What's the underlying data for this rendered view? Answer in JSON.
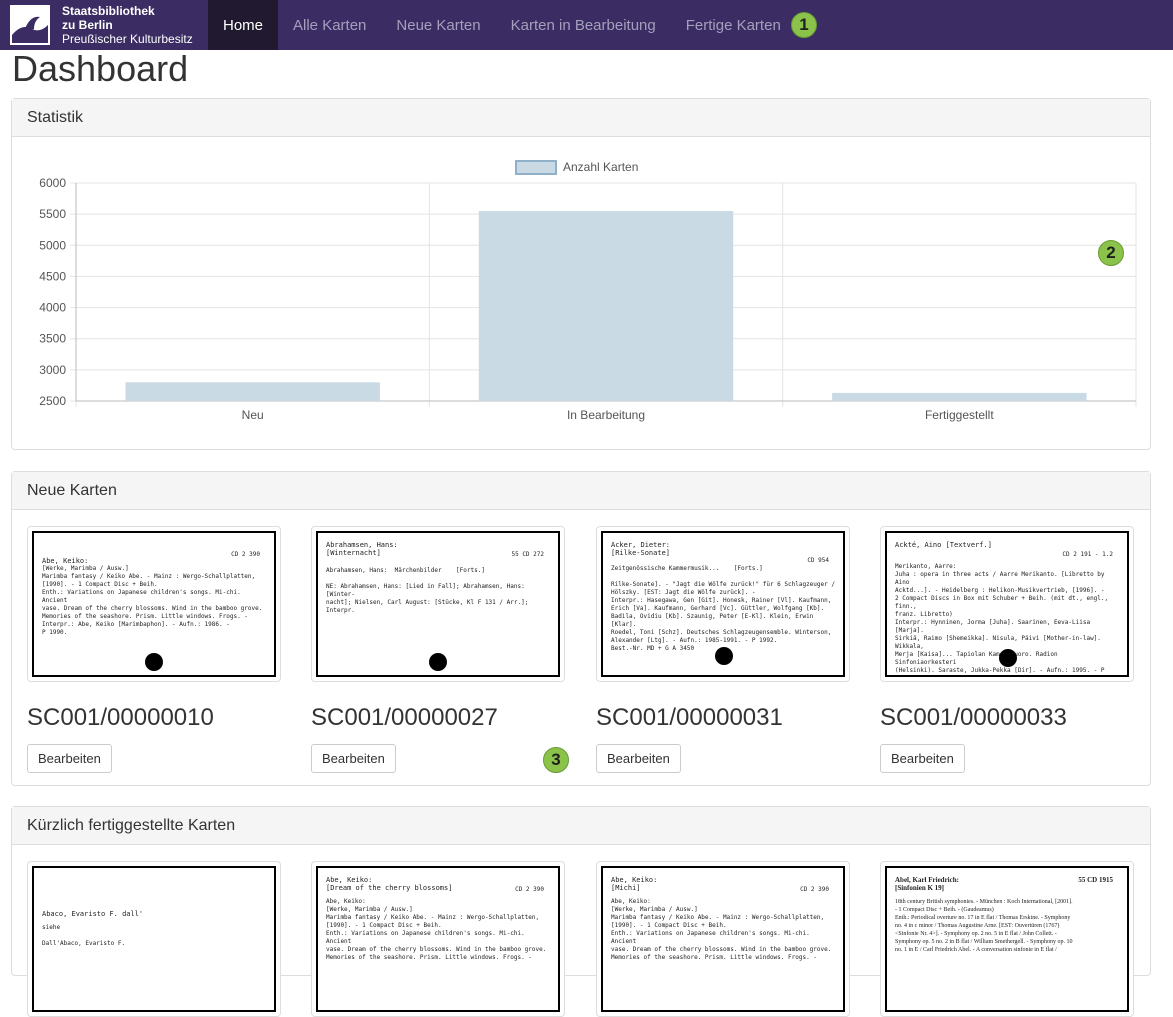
{
  "navbar": {
    "brand_line1": "Staatsbibliothek",
    "brand_line2": "zu Berlin",
    "brand_line3": "Preußischer Kulturbesitz",
    "items": [
      {
        "label": "Home",
        "active": true
      },
      {
        "label": "Alle Karten",
        "active": false
      },
      {
        "label": "Neue Karten",
        "active": false
      },
      {
        "label": "Karten in Bearbeitung",
        "active": false
      },
      {
        "label": "Fertige Karten",
        "active": false
      }
    ],
    "bg_color": "#3b2d63"
  },
  "markers": [
    "1",
    "2",
    "3"
  ],
  "page_title": "Dashboard",
  "statistik": {
    "heading": "Statistik"
  },
  "chart_data": {
    "type": "bar",
    "categories": [
      "Neu",
      "In Bearbeitung",
      "Fertiggestellt"
    ],
    "series": [
      {
        "name": "Anzahl Karten",
        "values": [
          2800,
          5550,
          2630
        ],
        "color": "#c9dae5"
      }
    ],
    "ylim": [
      2500,
      6000
    ],
    "yticks": [
      2500,
      3000,
      3500,
      4000,
      4500,
      5000,
      5500,
      6000
    ],
    "grid": true,
    "legend_position": "top-center"
  },
  "neue_karten": {
    "heading": "Neue Karten",
    "button_label": "Bearbeiten",
    "cards": [
      {
        "id": "SC001/00000010",
        "sig": "CD  2 390",
        "header": "Abe, Keiko:",
        "text": "[Werke, Marimba / Ausw.]\nMarimba fantasy / Keiko Abe. - Mainz : Wergo-Schallplatten,\n[1990]. - 1 Compact Disc + Beih.\nEnth.: Variations on Japanese children's songs. Mi-chi. Ancient\nvase. Dream of the cherry blossoms. Wind in the bamboo grove.\nMemories of the seashore. Prism. Little windows. Frogs. -\nInterpr.: Abe, Keiko [Marimbaphon]. - Aufn.: 1986. -\nP 1990."
      },
      {
        "id": "SC001/00000027",
        "sig": "55  CD  272",
        "header": "Abrahamsen, Hans:\n[Winternacht]",
        "text": "Abrahamsen, Hans:  Märchenbilder    [Forts.]\n\nNE: Abrahamsen, Hans: [Lied in Fall]; Abrahamsen, Hans: [Winter-\nnacht]; Nielsen, Carl August: [Stücke, Kl F 131 / Arr.]; Interpr."
      },
      {
        "id": "SC001/00000031",
        "sig": "CD  954",
        "header": "Acker, Dieter:\n[Rilke-Sonate]",
        "text": "Zeitgenössische Kammermusik...    [Forts.]\n\nRilke-Sonate]. - \"Jagt die Wölfe zurück!\" für 6 Schlagzeuger /\nHölszky. [EST: Jagt die Wölfe zurück]. -\nInterpr.: Hasegawa, Gen [Git]. Honesk, Rainer [Vl]. Kaufmann,\nErich [Va]. Kaufmann, Gerhard [Vc]. Güttler, Wolfgang [Kb].\nBadila, Ovidiu [Kb]. Szaunig, Peter [E-Kl]. Klein, Erwin [Klar].\nRoedel, Toni [Schz]. Deutsches Schlagzeugensemble. Winterson,\nAlexander [Ltg]. - Aufn.: 1985-1991. - P 1992.\nBest.-Nr. MD + G A 3450"
      },
      {
        "id": "SC001/00000033",
        "sig": "CD  2 191 - 1.2",
        "header": "Ackté, Aino [Textverf.]",
        "text": "Merikanto, Aarre:\nJuha : opera in three acts / Aarre Merikanto. [Libretto by Aino\nAcktd...]. - Heidelberg : Helikon-Musikvertrieb, [1996]. -\n2 Compact Discs in Box mit Schuber + Beih. (mit dt., engl., finn.,\nfranz. Libretto)\nInterpr.: Hynninen, Jorma [Juha]. Saarinen, Eeva-Liisa [Marja].\nSirkiä, Raimo [Shemeikka]. Nisula, Päivi [Mother-in-law]. Wikkala,\nMerja [Kaisa]... Tapiolan Kamarikuoro. Radion Sinfoniaorkesteri\n(Helsinki). Saraste, Jukka-Pekka [Dir]. - Aufn.: 1995. - P 1996.\nBest.-Nr. Ondine ODE 872-2 D\nNE: Ackté, Aino [Textverf.];      Interpr."
      }
    ]
  },
  "fertige_karten": {
    "heading": "Kürzlich fertiggestellte Karten",
    "cards": [
      {
        "header": "Abaco, Evaristo F. dall'",
        "sig": "",
        "text": "siehe\n\nDall'Abaco, Evaristo F."
      },
      {
        "header": "Abe, Keiko:\n[Dream of the cherry blossoms]",
        "sig": "CD  2 390",
        "text": "Abe, Keiko:\n[Werke, Marimba / Ausw.]\nMarimba fantasy / Keiko Abe. - Mainz : Wergo-Schallplatten,\n[1990]. - 1 Compact Disc + Beih.\nEnth.: Variations on Japanese children's songs. Mi-chi. Ancient\nvase. Dream of the cherry blossoms. Wind in the bamboo grove.\nMemories of the seashore. Prism. Little windows. Frogs. -"
      },
      {
        "header": "Abe, Keiko:\n[Michi]",
        "sig": "CD  2 390",
        "text": "Abe, Keiko:\n[Werke, Marimba / Ausw.]\nMarimba fantasy / Keiko Abe. - Mainz : Wergo-Schallplatten,\n[1990]. - 1 Compact Disc + Beih.\nEnth.: Variations on Japanese children's songs. Mi-chi. Ancient\nvase. Dream of the cherry blossoms. Wind in the bamboo grove.\nMemories of the seashore. Prism. Little windows. Frogs. -"
      },
      {
        "header": "Abel, Karl Friedrich:\n[Sinfonien K 19]",
        "sig": "55 CD 1915",
        "text": "18th century British symphonies. - München : Koch International, [2001].\n- 1 Compact Disc + Beih. - (Gaudeamus)\nEnth.: Periodical overture no. 17 in E flat / Thomas Erskine. - Symphony\nno. 4 in c minor / Thomas Augustine Arne. [EST: Ouvertüren (1767)\n<Sinfonie Nr. 4>]. - Symphony op. 2 no. 5 in E flat / John Collett. -\nSymphony op. 5 no. 2 in B flat / William Smethergell. - Symphony op. 10\nno. 1 in E / Carl Friedrich Abel. - A conversation sinfonie in E flat /"
      }
    ]
  }
}
